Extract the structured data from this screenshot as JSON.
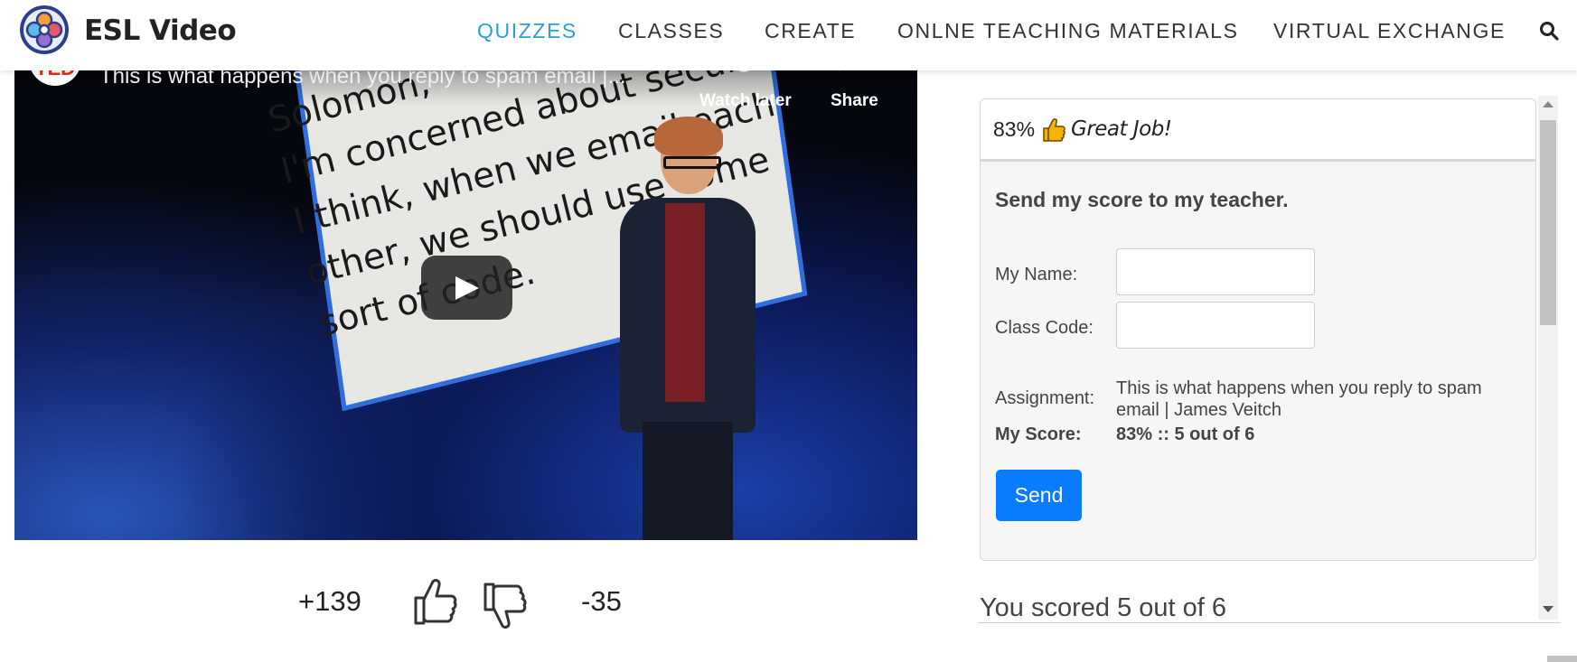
{
  "header": {
    "brand": "ESL Video",
    "nav": [
      "QUIZZES",
      "CLASSES",
      "CREATE",
      "ONLNE TEACHING MATERIALS",
      "VIRTUAL EXCHANGE"
    ],
    "active_nav": "QUIZZES",
    "accent_color": "#2a9fd6",
    "search_icon": "search-icon"
  },
  "video": {
    "channel": "TED",
    "title": "This is what happens when you reply to spam email |...",
    "watch_later": "Watch later",
    "share": "Share",
    "slide_text": "Solomon,\nI'm concerned about security.\nI think, when we email each\nother, we should use some\nsort of code."
  },
  "votes": {
    "up": "+139",
    "down": "-35"
  },
  "score_panel": {
    "percent": "83%",
    "praise": "Great Job!",
    "send_title": "Send my score to my teacher.",
    "name_label": "My Name:",
    "class_code_label": "Class Code:",
    "assignment_label": "Assignment:",
    "assignment_value": "This is what happens when you reply to spam email | James Veitch",
    "score_label": "My Score:",
    "score_value": "83% :: 5 out of 6",
    "send_button": "Send",
    "button_color": "#0a7cff",
    "summary": "You scored 5 out of 6"
  }
}
